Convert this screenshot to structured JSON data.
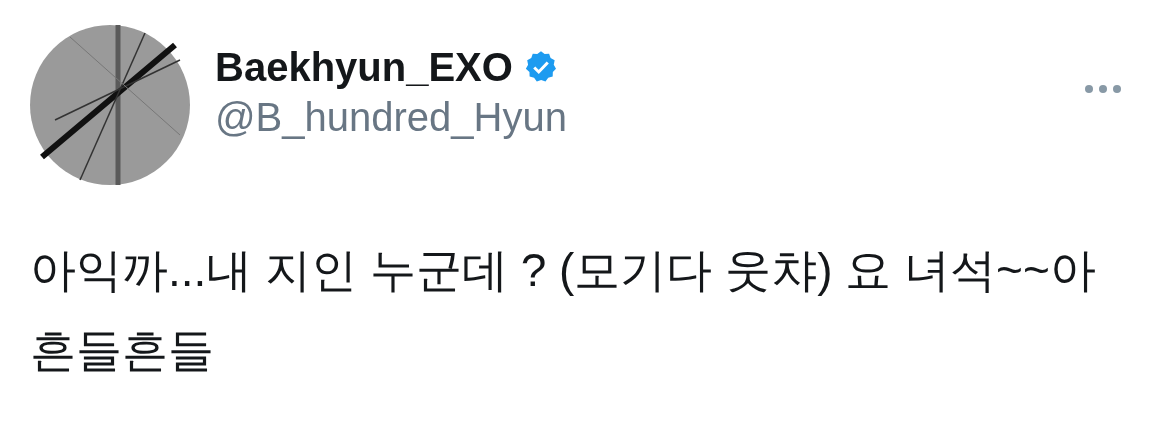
{
  "author": {
    "name": "Baekhyun_EXO",
    "verified": true,
    "handle": "@B_hundred_Hyun"
  },
  "tweet": {
    "text": "아익까...내 지인 누군데 ? (모기다 웃챠) 요 녀석~~아 흔들흔들"
  }
}
